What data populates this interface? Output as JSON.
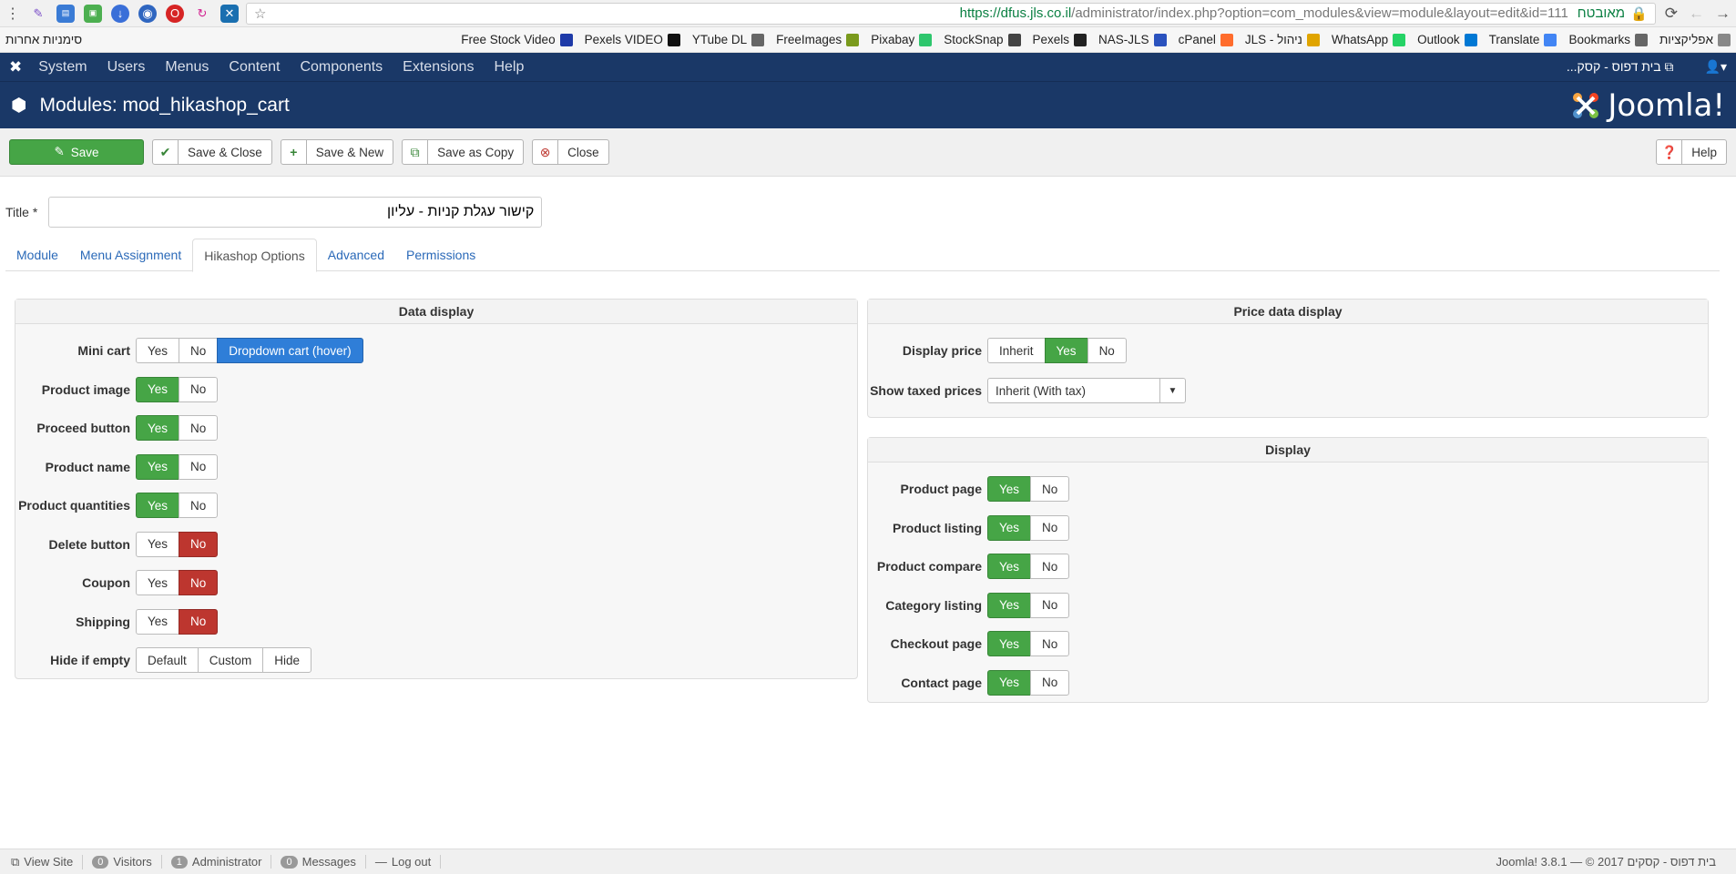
{
  "browser": {
    "url_host": "https://dfus.jls.co.il",
    "url_path": "/administrator/index.php?option=com_modules&view=module&layout=edit&id=111",
    "secure_label": "מאובטח",
    "bookmarks_other": "סימניות אחרות",
    "bookmarks": [
      {
        "label": "Free Stock Video",
        "color": "#1e3aa8"
      },
      {
        "label": "Pexels VIDEO",
        "color": "#111111"
      },
      {
        "label": "YTube DL",
        "color": "#666666"
      },
      {
        "label": "FreeImages",
        "color": "#7a9a1d"
      },
      {
        "label": "Pixabay",
        "color": "#2ec66d"
      },
      {
        "label": "StockSnap",
        "color": "#444444"
      },
      {
        "label": "Pexels",
        "color": "#222222"
      },
      {
        "label": "NAS-JLS",
        "color": "#2a52be"
      },
      {
        "label": "cPanel",
        "color": "#ff6c2c"
      },
      {
        "label": "JLS - ניהול",
        "color": "#e0a400"
      },
      {
        "label": "WhatsApp",
        "color": "#25d366"
      },
      {
        "label": "Outlook",
        "color": "#0078d4"
      },
      {
        "label": "Translate",
        "color": "#4285f4"
      },
      {
        "label": "Bookmarks",
        "color": "#666666"
      },
      {
        "label": "אפליקציות",
        "color": "#888888"
      }
    ]
  },
  "topnav": {
    "items": [
      "System",
      "Users",
      "Menus",
      "Content",
      "Components",
      "Extensions",
      "Help"
    ],
    "site_name": "...בית דפוס - קסק"
  },
  "header": {
    "title": "Modules: mod_hikashop_cart",
    "brand": "Joomla!"
  },
  "toolbar": {
    "save": "Save",
    "save_close": "Save & Close",
    "save_new": "Save & New",
    "save_copy": "Save as Copy",
    "close": "Close",
    "help": "Help"
  },
  "form": {
    "title_label": "Title *",
    "title_value": "קישור עגלת קניות - עליון"
  },
  "tabs": [
    "Module",
    "Menu Assignment",
    "Hikashop Options",
    "Advanced",
    "Permissions"
  ],
  "data_display": {
    "heading": "Data display",
    "rows": [
      {
        "label": "Mini cart",
        "options": [
          "Yes",
          "No",
          "Dropdown cart (hover)"
        ],
        "selected": 2,
        "style": "blue"
      },
      {
        "label": "Product image",
        "options": [
          "Yes",
          "No"
        ],
        "selected": 0,
        "style": "green"
      },
      {
        "label": "Proceed button",
        "options": [
          "Yes",
          "No"
        ],
        "selected": 0,
        "style": "green"
      },
      {
        "label": "Product name",
        "options": [
          "Yes",
          "No"
        ],
        "selected": 0,
        "style": "green"
      },
      {
        "label": "Product quantities",
        "options": [
          "Yes",
          "No"
        ],
        "selected": 0,
        "style": "green"
      },
      {
        "label": "Delete button",
        "options": [
          "Yes",
          "No"
        ],
        "selected": 1,
        "style": "red"
      },
      {
        "label": "Coupon",
        "options": [
          "Yes",
          "No"
        ],
        "selected": 1,
        "style": "red"
      },
      {
        "label": "Shipping",
        "options": [
          "Yes",
          "No"
        ],
        "selected": 1,
        "style": "red"
      },
      {
        "label": "Hide if empty",
        "options": [
          "Default",
          "Custom",
          "Hide"
        ],
        "selected": -1,
        "style": "none"
      }
    ]
  },
  "price_display": {
    "heading": "Price data display",
    "display_price": {
      "label": "Display price",
      "options": [
        "Inherit",
        "Yes",
        "No"
      ],
      "selected": 1
    },
    "taxed": {
      "label": "Show taxed prices",
      "value": "Inherit (With tax)"
    }
  },
  "display": {
    "heading": "Display",
    "rows": [
      {
        "label": "Product page",
        "options": [
          "Yes",
          "No"
        ],
        "selected": 0
      },
      {
        "label": "Product listing",
        "options": [
          "Yes",
          "No"
        ],
        "selected": 0
      },
      {
        "label": "Product compare",
        "options": [
          "Yes",
          "No"
        ],
        "selected": 0
      },
      {
        "label": "Category listing",
        "options": [
          "Yes",
          "No"
        ],
        "selected": 0
      },
      {
        "label": "Checkout page",
        "options": [
          "Yes",
          "No"
        ],
        "selected": 0
      },
      {
        "label": "Contact page",
        "options": [
          "Yes",
          "No"
        ],
        "selected": 0
      }
    ]
  },
  "status": {
    "view_site": "View Site",
    "visitors_count": "0",
    "visitors": "Visitors",
    "admin_count": "1",
    "admin": "Administrator",
    "messages_count": "0",
    "messages": "Messages",
    "logout": "Log out",
    "footer": "Joomla! 3.8.1 — © 2017 בית דפוס - קסקים"
  }
}
